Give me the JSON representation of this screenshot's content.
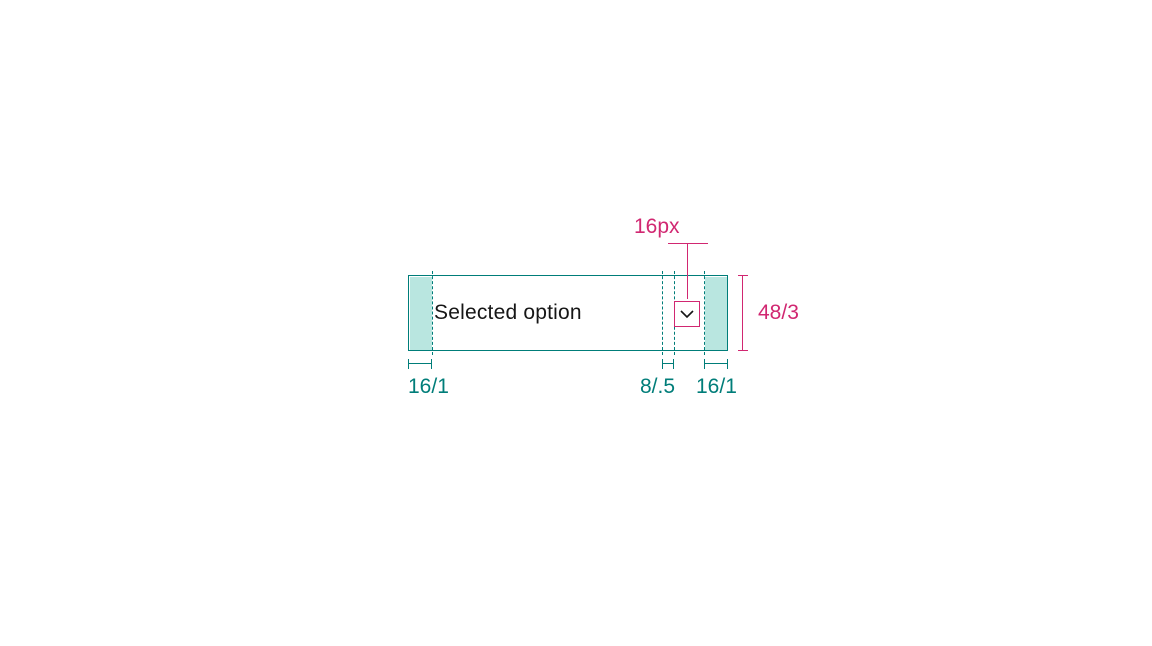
{
  "spec": {
    "component_name": "select",
    "placeholder_text": "Selected option",
    "icon": {
      "size_label": "16px",
      "name": "chevron-down"
    },
    "height_label": "48/3",
    "padding_left_label": "16/1",
    "gap_label": "8/.5",
    "padding_right_label": "16/1",
    "colors": {
      "outline_teal": "#007d79",
      "highlight_teal": "#b9e6e0",
      "accent_pink": "#d12771",
      "text": "#161616"
    }
  }
}
